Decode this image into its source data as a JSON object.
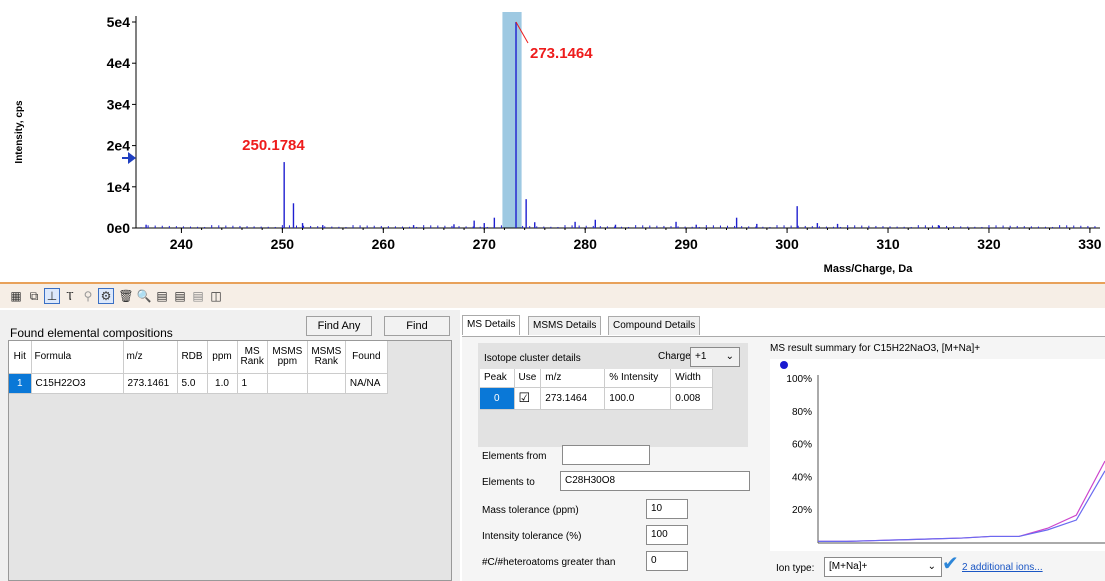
{
  "spectrum": {
    "ylabel": "Intensity, cps",
    "xlabel": "Mass/Charge, Da",
    "y_ticks": [
      "5e4",
      "4e4",
      "3e4",
      "2e4",
      "1e4",
      "0e0"
    ],
    "x_ticks": [
      "240",
      "250",
      "260",
      "270",
      "280",
      "290",
      "300",
      "310",
      "320",
      "330"
    ],
    "peak_labels": [
      "273.1464",
      "250.1784"
    ]
  },
  "chart_data": [
    {
      "type": "bar",
      "title": "",
      "xlabel": "Mass/Charge, Da",
      "ylabel": "Intensity, cps",
      "xlim": [
        235.5,
        331
      ],
      "ylim": [
        0,
        50000
      ],
      "x": [
        236.5,
        250.1784,
        251.1,
        252.0,
        254.0,
        263.0,
        267.0,
        269.0,
        270.0,
        271.0,
        273.1464,
        274.15,
        275.0,
        279.0,
        281.0,
        283.0,
        289.0,
        291.0,
        295.0,
        297.0,
        301.0,
        303.0,
        305.0,
        315.0
      ],
      "y": [
        800,
        16000,
        6000,
        1200,
        700,
        700,
        900,
        1800,
        1200,
        2500,
        50000,
        7000,
        1400,
        1500,
        2000,
        800,
        1500,
        800,
        2500,
        1000,
        5300,
        1200,
        1000,
        700
      ],
      "selected_range": [
        271.8,
        273.7
      ],
      "grid": false
    },
    {
      "type": "line",
      "title": "MS result summary for C15H22NaO3, [M+Na]+",
      "y_ticks": [
        "100%",
        "80%",
        "60%",
        "40%",
        "20%"
      ],
      "ylim": [
        0,
        100
      ],
      "series": [
        {
          "color": "#cc44cc",
          "values": [
            1,
            1,
            1.5,
            2,
            2.5,
            3,
            4,
            4,
            9,
            17,
            50
          ]
        },
        {
          "color": "#6a6af0",
          "values": [
            1,
            1,
            1.5,
            2,
            2.5,
            3,
            4,
            4,
            8,
            14,
            44
          ]
        }
      ]
    }
  ],
  "left_panel": {
    "title": "Found elemental compositions",
    "find_any": "Find Any",
    "find": "Find",
    "columns": [
      "Hit",
      "Formula",
      "m/z",
      "RDB",
      "ppm",
      "MS Rank",
      "MSMS ppm",
      "MSMS Rank",
      "Found"
    ],
    "rows": [
      {
        "hit": "1",
        "formula": "C15H22O3",
        "mz": "273.1461",
        "rdb": "5.0",
        "ppm": "1.0",
        "ms_rank": "1",
        "msms_ppm": "",
        "msms_rank": "",
        "found": "NA/NA"
      }
    ]
  },
  "tabs": [
    "MS Details",
    "MSMS Details",
    "Compound Details"
  ],
  "ms_details": {
    "isotope_title": "Isotope cluster details",
    "charge_label": "Charge",
    "charge_value": "+1",
    "isotope_columns": [
      "Peak",
      "Use",
      "m/z",
      "% Intensity",
      "Width"
    ],
    "isotope_row": {
      "peak": "0",
      "use": "☑",
      "mz": "273.1464",
      "intensity": "100.0",
      "width": "0.008"
    },
    "elements_from_label": "Elements from",
    "elements_from_value": "",
    "elements_to_label": "Elements to",
    "elements_to_value": "C28H30O8",
    "mass_tol_label": "Mass tolerance (ppm)",
    "mass_tol_value": "10",
    "int_tol_label": "Intensity tolerance (%)",
    "int_tol_value": "100",
    "hetero_label": "#C/#heteroatoms greater than",
    "hetero_value": "0",
    "summary_title": "MS result summary for C15H22NaO3, [M+Na]+",
    "ion_type_label": "Ion type:",
    "ion_type_value": "[M+Na]+",
    "additional_ions": "2 additional ions..."
  },
  "colors": {
    "peak": "#1f1fd0",
    "peak_label": "#ee1c1c",
    "selection": "#9ec9e2",
    "accent_border": "#e8a15a",
    "selected_row": "#0a78d7"
  }
}
